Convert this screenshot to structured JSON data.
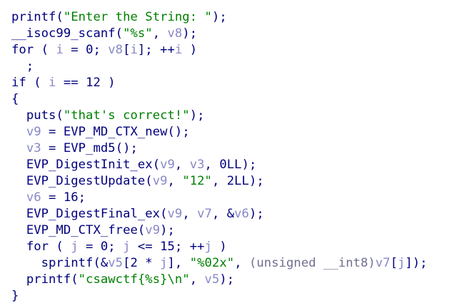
{
  "view": "pseudocode",
  "lines": [
    {
      "tokens": [
        {
          "t": "fn",
          "v": "printf"
        },
        {
          "t": "punc",
          "v": "("
        },
        {
          "t": "str",
          "v": "\"Enter the String: \""
        },
        {
          "t": "punc",
          "v": ");"
        }
      ]
    },
    {
      "tokens": [
        {
          "t": "fn",
          "v": "__isoc99_scanf"
        },
        {
          "t": "punc",
          "v": "("
        },
        {
          "t": "str",
          "v": "\"%s\""
        },
        {
          "t": "punc",
          "v": ", "
        },
        {
          "t": "var",
          "v": "v8"
        },
        {
          "t": "punc",
          "v": ");"
        }
      ]
    },
    {
      "tokens": [
        {
          "t": "kw",
          "v": "for"
        },
        {
          "t": "punc",
          "v": " ( "
        },
        {
          "t": "var",
          "v": "i"
        },
        {
          "t": "punc",
          "v": " = "
        },
        {
          "t": "num",
          "v": "0"
        },
        {
          "t": "punc",
          "v": "; "
        },
        {
          "t": "var",
          "v": "v8"
        },
        {
          "t": "punc",
          "v": "["
        },
        {
          "t": "var",
          "v": "i"
        },
        {
          "t": "punc",
          "v": "]; ++"
        },
        {
          "t": "var",
          "v": "i"
        },
        {
          "t": "punc",
          "v": " )"
        }
      ]
    },
    {
      "tokens": [
        {
          "t": "punc",
          "v": "  ;"
        }
      ]
    },
    {
      "tokens": [
        {
          "t": "kw",
          "v": "if"
        },
        {
          "t": "punc",
          "v": " ( "
        },
        {
          "t": "var",
          "v": "i"
        },
        {
          "t": "punc",
          "v": " == "
        },
        {
          "t": "num",
          "v": "12"
        },
        {
          "t": "punc",
          "v": " )"
        }
      ]
    },
    {
      "tokens": [
        {
          "t": "punc",
          "v": "{"
        }
      ]
    },
    {
      "tokens": [
        {
          "t": "punc",
          "v": "  "
        },
        {
          "t": "fn",
          "v": "puts"
        },
        {
          "t": "punc",
          "v": "("
        },
        {
          "t": "str",
          "v": "\"that's correct!\""
        },
        {
          "t": "punc",
          "v": ");"
        }
      ]
    },
    {
      "tokens": [
        {
          "t": "punc",
          "v": "  "
        },
        {
          "t": "var",
          "v": "v9"
        },
        {
          "t": "punc",
          "v": " = "
        },
        {
          "t": "fn",
          "v": "EVP_MD_CTX_new"
        },
        {
          "t": "punc",
          "v": "();"
        }
      ]
    },
    {
      "tokens": [
        {
          "t": "punc",
          "v": "  "
        },
        {
          "t": "var",
          "v": "v3"
        },
        {
          "t": "punc",
          "v": " = "
        },
        {
          "t": "fn",
          "v": "EVP_md5"
        },
        {
          "t": "punc",
          "v": "();"
        }
      ]
    },
    {
      "tokens": [
        {
          "t": "punc",
          "v": "  "
        },
        {
          "t": "fn",
          "v": "EVP_DigestInit_ex"
        },
        {
          "t": "punc",
          "v": "("
        },
        {
          "t": "var",
          "v": "v9"
        },
        {
          "t": "punc",
          "v": ", "
        },
        {
          "t": "var",
          "v": "v3"
        },
        {
          "t": "punc",
          "v": ", "
        },
        {
          "t": "num",
          "v": "0LL"
        },
        {
          "t": "punc",
          "v": ");"
        }
      ]
    },
    {
      "tokens": [
        {
          "t": "punc",
          "v": "  "
        },
        {
          "t": "fn",
          "v": "EVP_DigestUpdate"
        },
        {
          "t": "punc",
          "v": "("
        },
        {
          "t": "var",
          "v": "v9"
        },
        {
          "t": "punc",
          "v": ", "
        },
        {
          "t": "str",
          "v": "\"12\""
        },
        {
          "t": "punc",
          "v": ", "
        },
        {
          "t": "num",
          "v": "2LL"
        },
        {
          "t": "punc",
          "v": ");"
        }
      ]
    },
    {
      "tokens": [
        {
          "t": "punc",
          "v": "  "
        },
        {
          "t": "var",
          "v": "v6"
        },
        {
          "t": "punc",
          "v": " = "
        },
        {
          "t": "num",
          "v": "16"
        },
        {
          "t": "punc",
          "v": ";"
        }
      ]
    },
    {
      "tokens": [
        {
          "t": "punc",
          "v": "  "
        },
        {
          "t": "fn",
          "v": "EVP_DigestFinal_ex"
        },
        {
          "t": "punc",
          "v": "("
        },
        {
          "t": "var",
          "v": "v9"
        },
        {
          "t": "punc",
          "v": ", "
        },
        {
          "t": "var",
          "v": "v7"
        },
        {
          "t": "punc",
          "v": ", &"
        },
        {
          "t": "var",
          "v": "v6"
        },
        {
          "t": "punc",
          "v": ");"
        }
      ]
    },
    {
      "tokens": [
        {
          "t": "punc",
          "v": "  "
        },
        {
          "t": "fn",
          "v": "EVP_MD_CTX_free"
        },
        {
          "t": "punc",
          "v": "("
        },
        {
          "t": "var",
          "v": "v9"
        },
        {
          "t": "punc",
          "v": ");"
        }
      ]
    },
    {
      "tokens": [
        {
          "t": "punc",
          "v": "  "
        },
        {
          "t": "kw",
          "v": "for"
        },
        {
          "t": "punc",
          "v": " ( "
        },
        {
          "t": "var",
          "v": "j"
        },
        {
          "t": "punc",
          "v": " = "
        },
        {
          "t": "num",
          "v": "0"
        },
        {
          "t": "punc",
          "v": "; "
        },
        {
          "t": "var",
          "v": "j"
        },
        {
          "t": "punc",
          "v": " <= "
        },
        {
          "t": "num",
          "v": "15"
        },
        {
          "t": "punc",
          "v": "; ++"
        },
        {
          "t": "var",
          "v": "j"
        },
        {
          "t": "punc",
          "v": " )"
        }
      ]
    },
    {
      "tokens": [
        {
          "t": "punc",
          "v": "    "
        },
        {
          "t": "fn",
          "v": "sprintf"
        },
        {
          "t": "punc",
          "v": "(&"
        },
        {
          "t": "var",
          "v": "v5"
        },
        {
          "t": "punc",
          "v": "["
        },
        {
          "t": "num",
          "v": "2"
        },
        {
          "t": "punc",
          "v": " * "
        },
        {
          "t": "var",
          "v": "j"
        },
        {
          "t": "punc",
          "v": "], "
        },
        {
          "t": "str",
          "v": "\"%02x\""
        },
        {
          "t": "punc",
          "v": ", "
        },
        {
          "t": "type",
          "v": "(unsigned __int8)"
        },
        {
          "t": "var",
          "v": "v7"
        },
        {
          "t": "punc",
          "v": "["
        },
        {
          "t": "var",
          "v": "j"
        },
        {
          "t": "punc",
          "v": "]);"
        }
      ]
    },
    {
      "tokens": [
        {
          "t": "punc",
          "v": "  "
        },
        {
          "t": "fn",
          "v": "printf"
        },
        {
          "t": "punc",
          "v": "("
        },
        {
          "t": "str",
          "v": "\"csawctf{%s}\\n\""
        },
        {
          "t": "punc",
          "v": ", "
        },
        {
          "t": "var",
          "v": "v5"
        },
        {
          "t": "punc",
          "v": ");"
        }
      ]
    },
    {
      "tokens": [
        {
          "t": "punc",
          "v": "}"
        }
      ]
    }
  ],
  "colors": {
    "background": "#ffffff",
    "code": "#00007f",
    "string": "#008000",
    "variable": "#8888c8",
    "type": "#707090"
  }
}
